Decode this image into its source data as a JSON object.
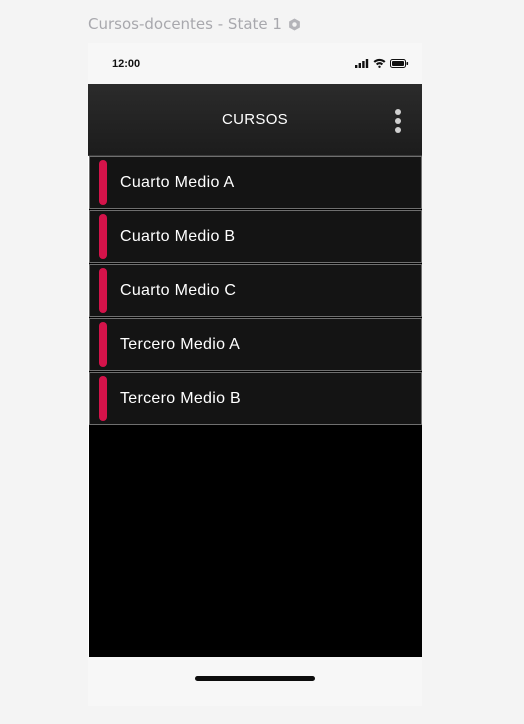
{
  "artboard": {
    "label": "Cursos-docentes - State 1",
    "state_icon": "hexagon-icon"
  },
  "status_bar": {
    "time": "12:00",
    "icons": [
      "signal-icon",
      "wifi-icon",
      "battery-icon"
    ]
  },
  "app_bar": {
    "title": "CURSOS",
    "menu_icon": "more-vertical-icon"
  },
  "courses": [
    {
      "label": "Cuarto Medio A"
    },
    {
      "label": "Cuarto Medio B"
    },
    {
      "label": "Cuarto Medio C"
    },
    {
      "label": "Tercero Medio A"
    },
    {
      "label": "Tercero Medio B"
    }
  ],
  "colors": {
    "accent": "#d4134a",
    "background": "#000000",
    "list_item": "#141414",
    "app_bar": "#232323"
  }
}
